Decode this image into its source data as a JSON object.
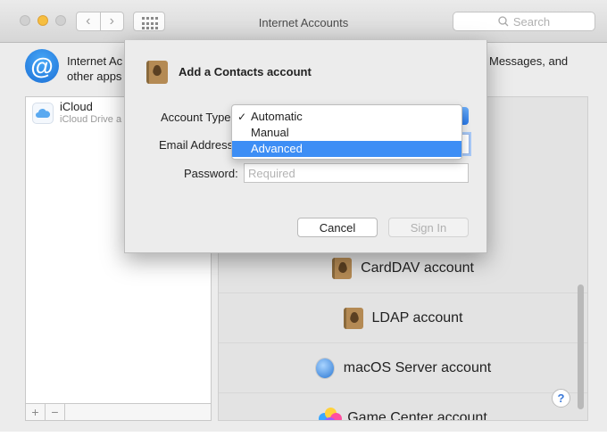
{
  "window": {
    "title": "Internet Accounts",
    "search_placeholder": "Search",
    "nav_back_glyph": "‹",
    "nav_forward_glyph": "›"
  },
  "header": {
    "icon_glyph": "@",
    "description_left": "Internet Ac… other apps",
    "description_left_line1": "Internet Ac",
    "description_left_line2": "other apps",
    "description_right": "Messages, and"
  },
  "accounts": [
    {
      "name": "iCloud",
      "subtitle": "iCloud Drive a",
      "icon": "icloud-icon"
    }
  ],
  "list_controls": {
    "add": "+",
    "remove": "−"
  },
  "services": [
    {
      "label": "CardDAV account",
      "icon": "contacts-book-icon"
    },
    {
      "label": "LDAP account",
      "icon": "contacts-book-icon"
    },
    {
      "label": "macOS Server account",
      "icon": "globe-icon"
    },
    {
      "label": "Game Center account",
      "icon": "game-center-icon"
    }
  ],
  "help_glyph": "?",
  "dialog": {
    "title": "Add a Contacts account",
    "account_type_label": "Account Type",
    "email_label": "Email Address",
    "password_label": "Password:",
    "password_placeholder": "Required",
    "cancel": "Cancel",
    "sign_in": "Sign In"
  },
  "dropdown": {
    "check_glyph": "✓",
    "options": [
      "Automatic",
      "Manual",
      "Advanced"
    ],
    "checked": "Automatic",
    "highlighted": "Advanced"
  },
  "colors": {
    "accent": "#3d8ef5",
    "window_bg": "#ececec",
    "minimize": "#f6be3f"
  }
}
